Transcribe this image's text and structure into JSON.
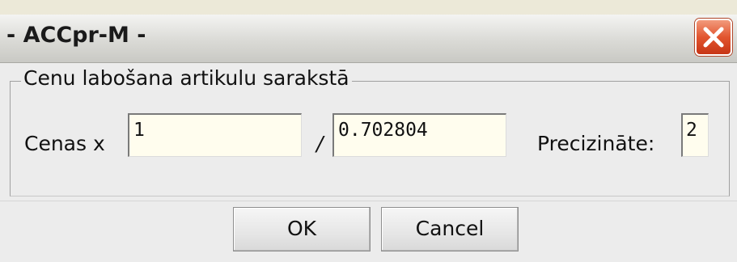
{
  "window": {
    "title": "- ACCpr-M -"
  },
  "group": {
    "title": "Cenu labošana artikulu sarakstā"
  },
  "form": {
    "multiplier_label": "Cenas x",
    "multiplier_value": "1",
    "divider_label": "/",
    "divider_value": "0.702804",
    "precision_label": "Precizināte:",
    "precision_value": "2"
  },
  "buttons": {
    "ok_label": "OK",
    "cancel_label": "Cancel"
  },
  "icons": {
    "close": "close-icon"
  }
}
